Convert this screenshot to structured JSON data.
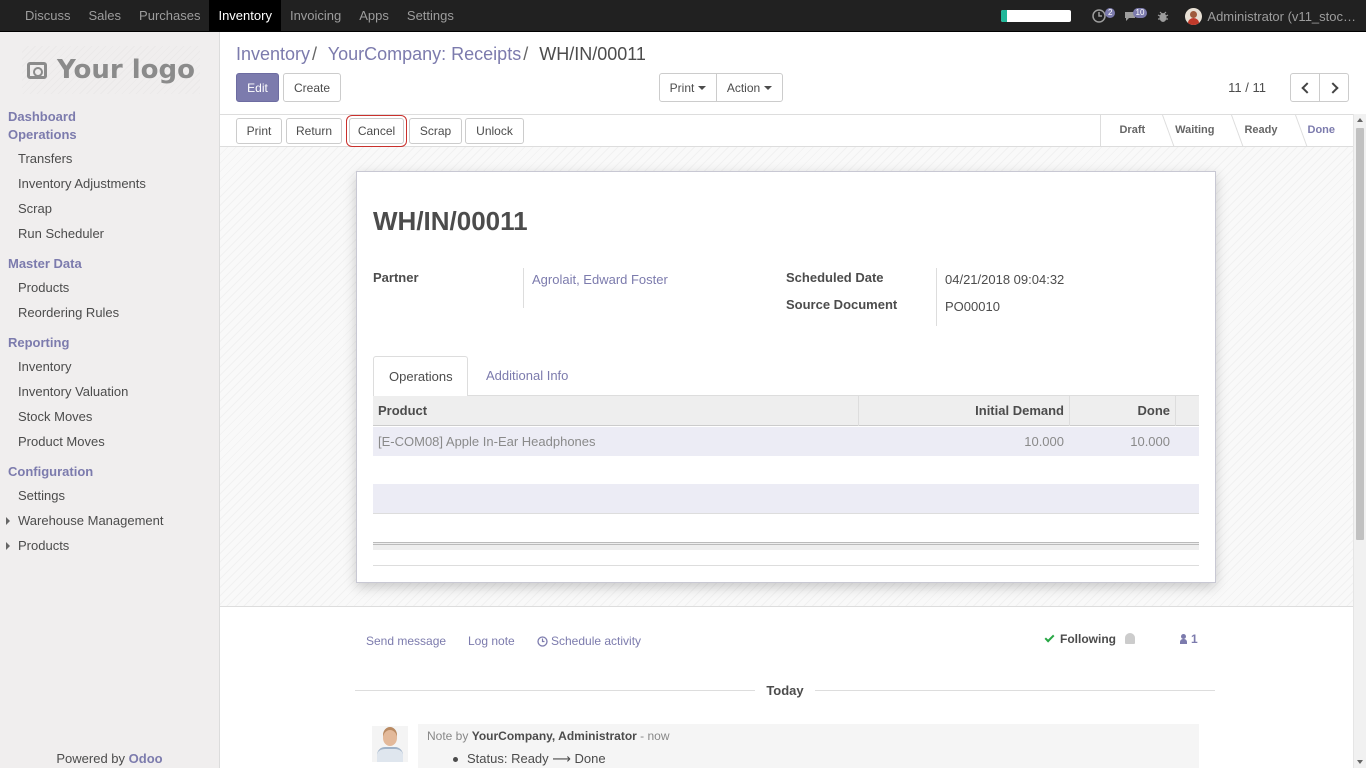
{
  "topbar": {
    "apps": [
      "Discuss",
      "Sales",
      "Purchases",
      "Inventory",
      "Invoicing",
      "Apps",
      "Settings"
    ],
    "active_app": "Inventory",
    "progress_fraction": 0.08,
    "activity_count": "2",
    "message_count": "10",
    "user": "Administrator (v11_stoc…"
  },
  "sidebar": {
    "logo_text": "Your logo",
    "sections": {
      "dashboard": "Dashboard",
      "operations": "Operations",
      "master_data": "Master Data",
      "reporting": "Reporting",
      "configuration": "Configuration"
    },
    "items": {
      "transfers": "Transfers",
      "inventory_adjustments": "Inventory Adjustments",
      "scrap": "Scrap",
      "run_scheduler": "Run Scheduler",
      "products": "Products",
      "reordering_rules": "Reordering Rules",
      "inventory": "Inventory",
      "inventory_valuation": "Inventory Valuation",
      "stock_moves": "Stock Moves",
      "product_moves": "Product Moves",
      "settings": "Settings",
      "warehouse_management": "Warehouse Management",
      "products_config": "Products"
    },
    "powered_by": "Powered by",
    "powered_brand": "Odoo"
  },
  "control_panel": {
    "breadcrumb": [
      "Inventory",
      "YourCompany: Receipts",
      "WH/IN/00011"
    ],
    "edit": "Edit",
    "create": "Create",
    "print": "Print",
    "action": "Action",
    "pager": "11 / 11"
  },
  "statusbar": {
    "buttons": {
      "print": "Print",
      "return": "Return",
      "cancel": "Cancel",
      "scrap": "Scrap",
      "unlock": "Unlock"
    },
    "stages": [
      "Draft",
      "Waiting",
      "Ready",
      "Done"
    ],
    "active_stage": "Done"
  },
  "form": {
    "title": "WH/IN/00011",
    "partner_label": "Partner",
    "partner_value": "Agrolait, Edward Foster",
    "scheduled_date_label": "Scheduled Date",
    "scheduled_date_value": "04/21/2018 09:04:32",
    "source_document_label": "Source Document",
    "source_document_value": "PO00010",
    "tabs": [
      "Operations",
      "Additional Info"
    ],
    "table": {
      "headers": [
        "Product",
        "Initial Demand",
        "Done"
      ],
      "rows": [
        {
          "product": "[E-COM08] Apple In-Ear Headphones",
          "initial_demand": "10.000",
          "done": "10.000"
        }
      ]
    }
  },
  "chatter": {
    "send_message": "Send message",
    "log_note": "Log note",
    "schedule_activity": "Schedule activity",
    "following": "Following",
    "followers_count": "1",
    "date_separator": "Today",
    "message": {
      "prefix": "Note by",
      "author": "YourCompany, Administrator",
      "time": "- now",
      "body_from": "Status: Ready",
      "arrow": "⟶",
      "body_to": "Done"
    }
  }
}
